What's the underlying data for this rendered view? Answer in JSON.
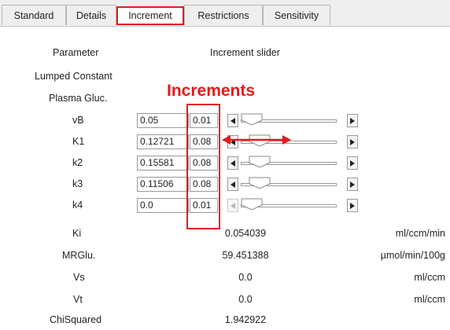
{
  "tabs": [
    {
      "label": "Standard"
    },
    {
      "label": "Details"
    },
    {
      "label": "Increment",
      "active": true
    },
    {
      "label": "Restrictions"
    },
    {
      "label": "Sensitivity"
    }
  ],
  "headers": {
    "parameter": "Parameter",
    "increment_slider": "Increment slider"
  },
  "static_params": {
    "lumped_constant": "Lumped Constant",
    "plasma_gluc": "Plasma Gluc."
  },
  "annotation": {
    "title": "Increments",
    "color": "#e31b1b"
  },
  "params": [
    {
      "name": "vB",
      "value": "0.05",
      "increment": "0.01",
      "enabled": true
    },
    {
      "name": "K1",
      "value": "0.12721",
      "increment": "0.08",
      "enabled": true
    },
    {
      "name": "k2",
      "value": "0.15581",
      "increment": "0.08",
      "enabled": true
    },
    {
      "name": "k3",
      "value": "0.11506",
      "increment": "0.08",
      "enabled": true
    },
    {
      "name": "k4",
      "value": "0.0",
      "increment": "0.01",
      "enabled": false
    }
  ],
  "results": [
    {
      "name": "Ki",
      "value": "0.054039",
      "unit": "ml/ccm/min"
    },
    {
      "name": "MRGlu.",
      "value": "59.451388",
      "unit": "µmol/min/100g"
    },
    {
      "name": "Vs",
      "value": "0.0",
      "unit": "ml/ccm"
    },
    {
      "name": "Vt",
      "value": "0.0",
      "unit": "ml/ccm"
    },
    {
      "name": "ChiSquared",
      "value": "1.942922",
      "unit": ""
    }
  ]
}
